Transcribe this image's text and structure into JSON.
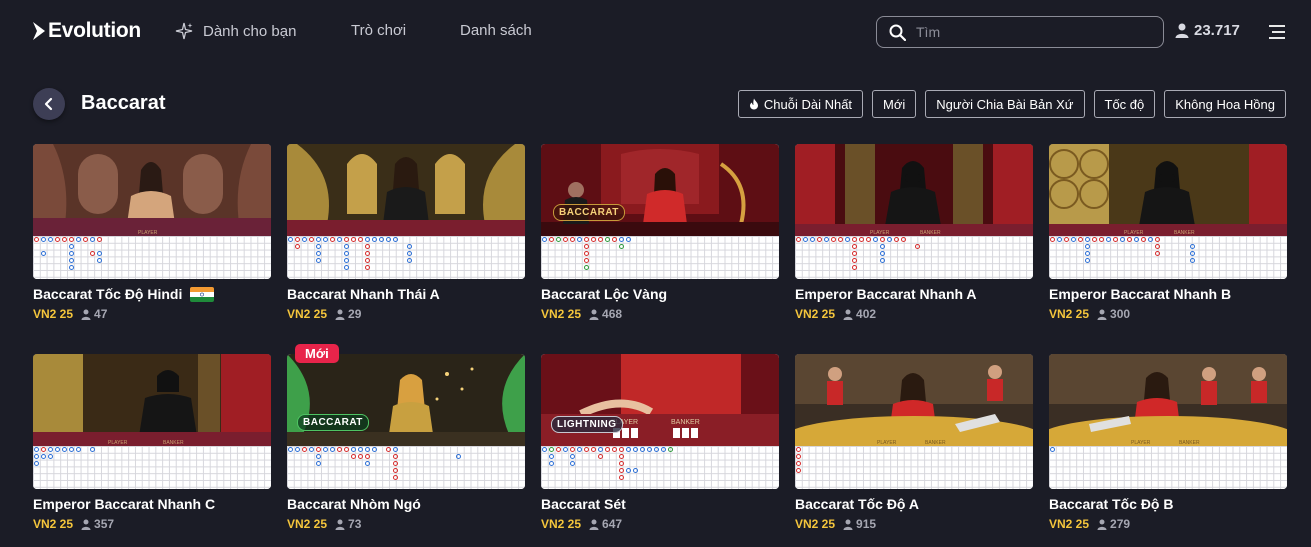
{
  "brand": {
    "name": "Evolution"
  },
  "nav": {
    "for_you": "Dành cho bạn",
    "games": "Trò chơi",
    "lists": "Danh sách"
  },
  "search": {
    "placeholder": "Tìm"
  },
  "players_online": "23.717",
  "page": {
    "title": "Baccarat"
  },
  "filters": [
    {
      "label": "Chuỗi Dài Nhất",
      "icon": "fire-icon"
    },
    {
      "label": "Mới"
    },
    {
      "label": "Người Chia Bài Bản Xứ"
    },
    {
      "label": "Tốc độ"
    },
    {
      "label": "Không Hoa Hồng"
    }
  ],
  "games": [
    {
      "name": "Baccarat Tốc Độ Hindi",
      "bet": "VN2 25",
      "players": "47",
      "flag": "india",
      "badge": ""
    },
    {
      "name": "Baccarat Nhanh Thái A",
      "bet": "VN2 25",
      "players": "29",
      "badge": ""
    },
    {
      "name": "Baccarat Lộc Vàng",
      "bet": "VN2 25",
      "players": "468",
      "badge": "",
      "overlay": "BACCARAT"
    },
    {
      "name": "Emperor Baccarat Nhanh A",
      "bet": "VN2 25",
      "players": "402",
      "badge": ""
    },
    {
      "name": "Emperor Baccarat Nhanh B",
      "bet": "VN2 25",
      "players": "300",
      "badge": ""
    },
    {
      "name": "Emperor Baccarat Nhanh C",
      "bet": "VN2 25",
      "players": "357",
      "badge": ""
    },
    {
      "name": "Baccarat Nhòm Ngó",
      "bet": "VN2 25",
      "players": "73",
      "badge": "Mới",
      "overlay": "BACCARAT"
    },
    {
      "name": "Baccarat Sét",
      "bet": "VN2 25",
      "players": "647",
      "badge": "",
      "overlay": "LIGHTNING"
    },
    {
      "name": "Baccarat Tốc Độ A",
      "bet": "VN2 25",
      "players": "915",
      "badge": ""
    },
    {
      "name": "Baccarat Tốc Độ B",
      "bet": "VN2 25",
      "players": "279",
      "badge": ""
    }
  ],
  "colors": {
    "background": "#1b1c26",
    "bet_accent": "#f4c53c",
    "new_badge": "#e8244a",
    "banker_red": "#d62c2c",
    "player_blue": "#2c6fd6"
  }
}
